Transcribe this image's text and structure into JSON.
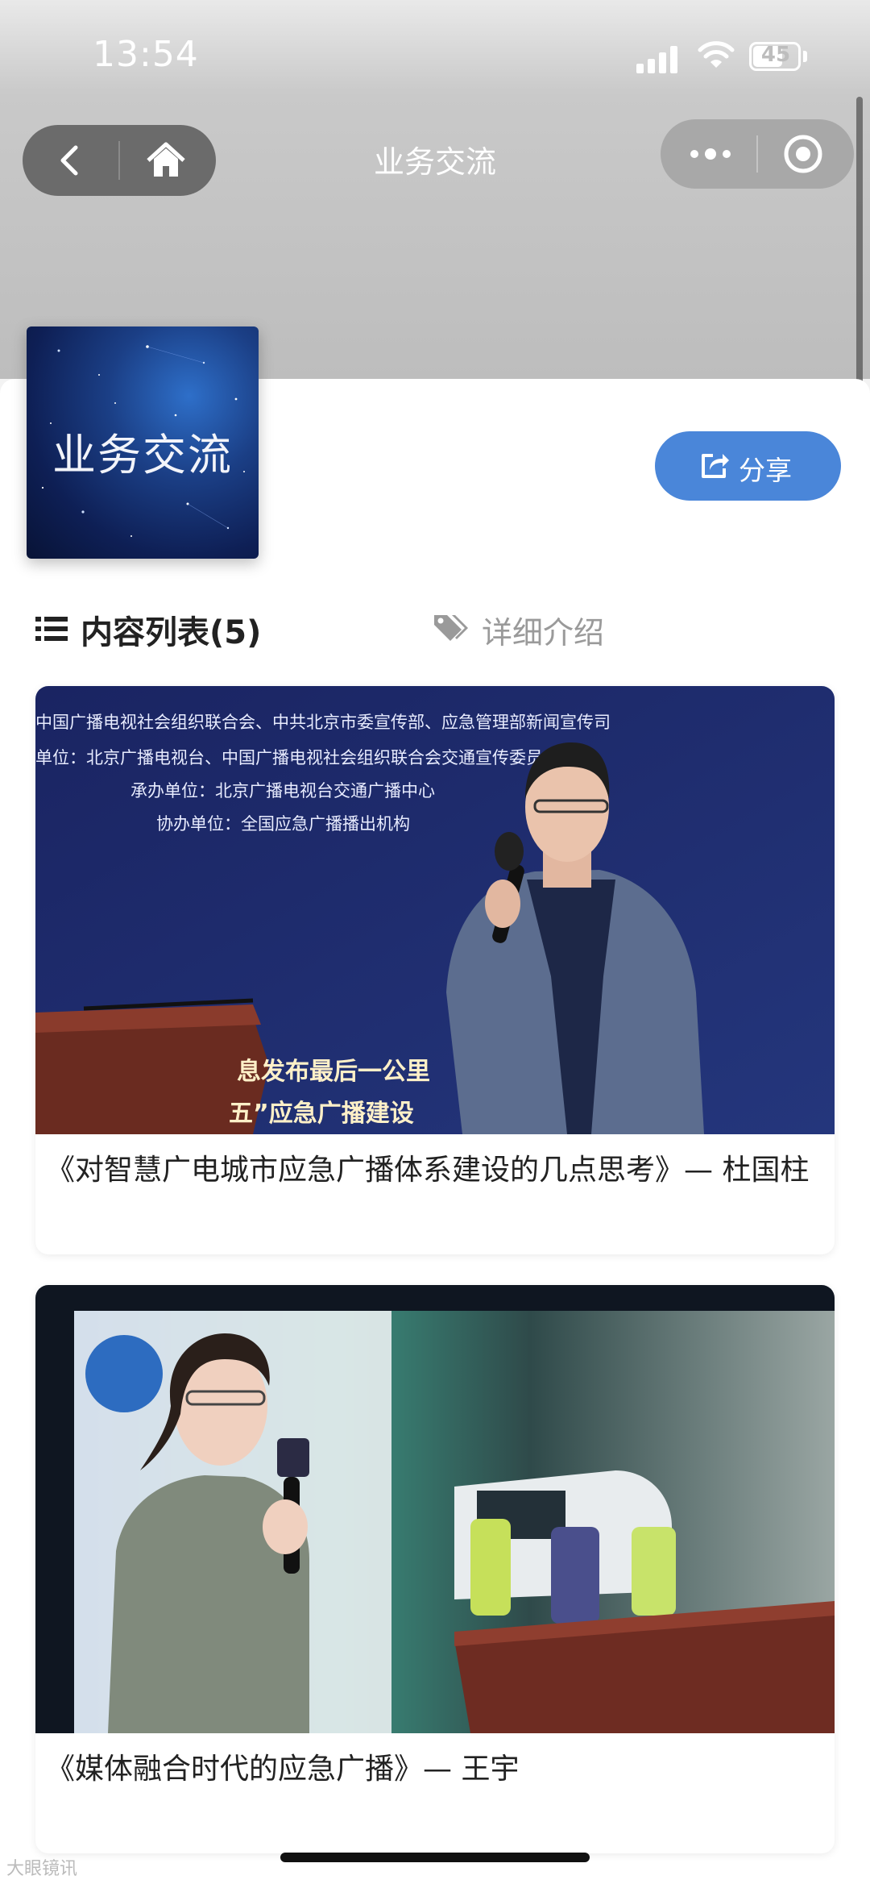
{
  "status_bar": {
    "time": "13:54",
    "battery": "45"
  },
  "nav": {
    "title": "业务交流"
  },
  "header": {
    "cover_text": "业务交流",
    "share_label": "分享"
  },
  "tabs": {
    "list_label": "内容列表(5)",
    "detail_label": "详细介绍"
  },
  "items": [
    {
      "title": "《对智慧广电城市应急广播体系建设的几点思考》— 杜国柱",
      "photo_lines": [
        "中国广播电视社会组织联合会、中共北京市委宣传部、应急管理部新闻宣传司",
        "单位：北京广播电视台、中国广播电视社会组织联合会交通宣传委员会",
        "承办单位：北京广播电视台交通广播中心",
        "协办单位：全国应急广播播出机构"
      ],
      "photo_banner": [
        "息发布最后一公里",
        "五”应急广播建设"
      ]
    },
    {
      "title": "《媒体融合时代的应急广播》— 王宇"
    }
  ],
  "watermark": "大眼镜讯",
  "colors": {
    "share_button": "#4a86d9",
    "header_gray": "#bdbdbd",
    "photo1_bg": "#1c2a66"
  }
}
